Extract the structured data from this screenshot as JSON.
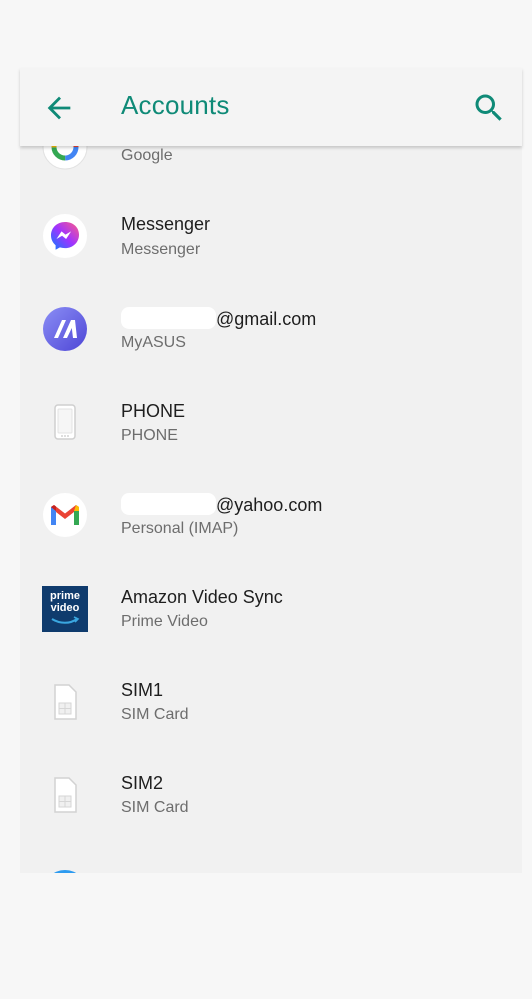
{
  "appbar": {
    "title": "Accounts",
    "back_icon": "arrow-left-icon",
    "search_icon": "search-icon",
    "accent_color": "#0f8a77"
  },
  "accounts": [
    {
      "primary": "",
      "secondary": "Google",
      "icon": "google-icon"
    },
    {
      "primary": "Messenger",
      "secondary": "Messenger",
      "icon": "messenger-icon"
    },
    {
      "primary": "@gmail.com",
      "secondary": "MyASUS",
      "icon": "myasus-icon"
    },
    {
      "primary": "PHONE",
      "secondary": "PHONE",
      "icon": "phone-icon"
    },
    {
      "primary": "@yahoo.com",
      "secondary": "Personal (IMAP)",
      "icon": "gmail-icon"
    },
    {
      "primary": "Amazon Video Sync",
      "secondary": "Prime Video",
      "icon": "prime-video-icon",
      "logo_text_1": "prime",
      "logo_text_2": "video"
    },
    {
      "primary": "SIM1",
      "secondary": "SIM Card",
      "icon": "sim-card-icon"
    },
    {
      "primary": "SIM2",
      "secondary": "SIM Card",
      "icon": "sim-card-icon"
    },
    {
      "primary": "",
      "secondary": "",
      "icon": "account-icon"
    }
  ]
}
